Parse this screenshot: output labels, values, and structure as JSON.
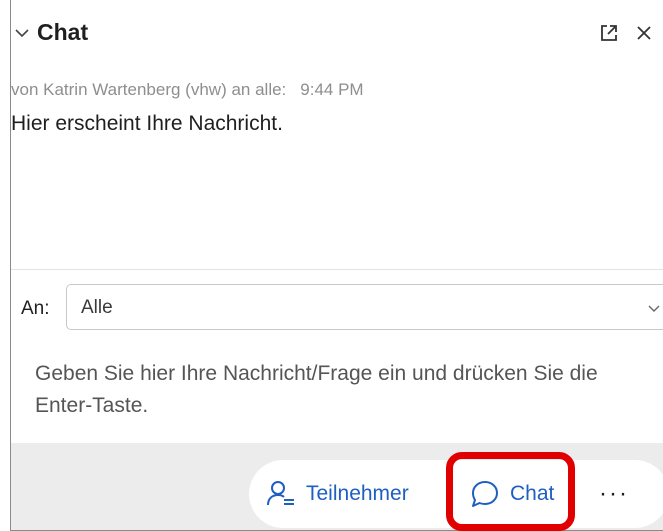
{
  "header": {
    "title": "Chat",
    "icons": {
      "collapse": "chevron-down-icon",
      "popout": "pop-out-icon",
      "close": "close-icon"
    },
    "close_glyph": "✕"
  },
  "messages": [
    {
      "meta": "von Katrin Wartenberg (vhw) an alle:",
      "time": "9:44 PM",
      "text": "Hier erscheint Ihre Nachricht."
    }
  ],
  "recipient": {
    "label": "An:",
    "selected": "Alle"
  },
  "composer": {
    "placeholder": "Geben Sie hier Ihre Nachricht/Frage ein und drücken Sie die Enter-Taste."
  },
  "footer": {
    "participants_label": "Teilnehmer",
    "chat_label": "Chat",
    "more_label": "···",
    "icons": {
      "participants": "participants-icon",
      "chat": "chat-bubble-icon",
      "more": "more-icon"
    }
  },
  "colors": {
    "accent": "#1e5fc2",
    "highlight": "#e00000",
    "footer_bg": "#ececec"
  }
}
